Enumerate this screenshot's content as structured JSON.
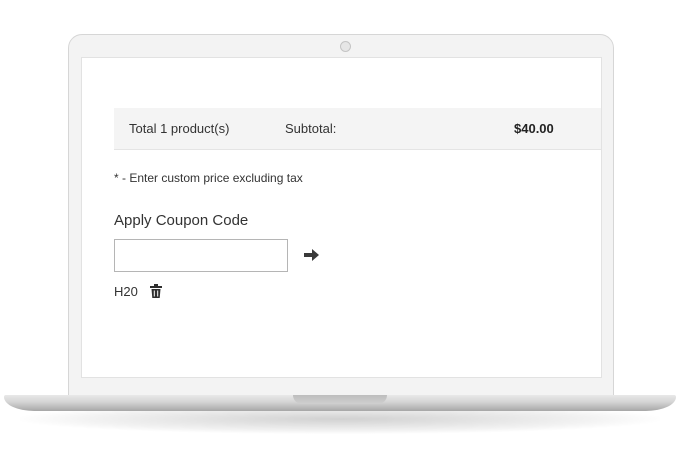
{
  "cart": {
    "total_products": "Total 1 product(s)",
    "subtotal_label": "Subtotal:",
    "subtotal_value": "$40.00"
  },
  "tax_note": "* - Enter custom price excluding tax",
  "coupon": {
    "heading": "Apply Coupon Code",
    "input_value": "",
    "apply_icon": "arrow-right-icon",
    "applied_code": "H20",
    "remove_icon": "trash-icon"
  }
}
